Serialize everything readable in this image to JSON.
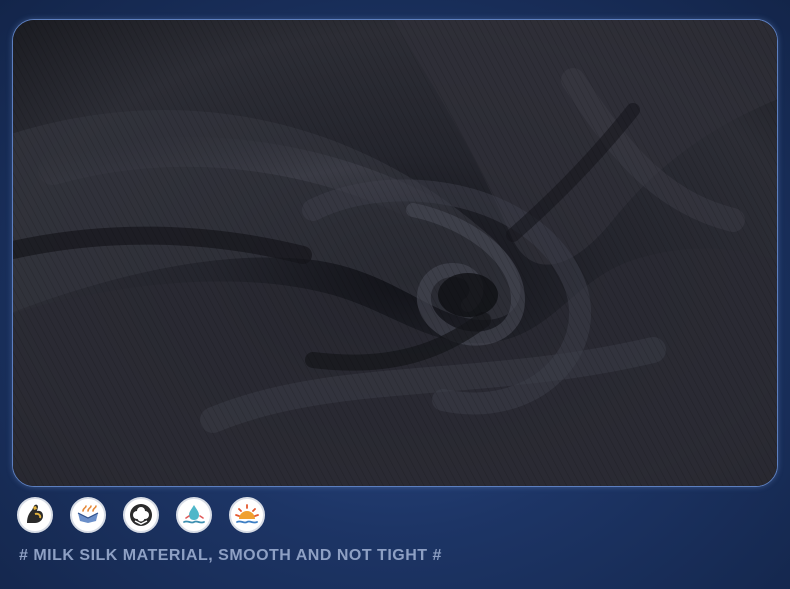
{
  "photo": {
    "subject": "black milk silk fabric swirl",
    "fabric_color": "#1d1e25"
  },
  "feature_icons": [
    {
      "name": "flexed-arm-icon"
    },
    {
      "name": "breathable-fabric-icon"
    },
    {
      "name": "cotton-flower-icon"
    },
    {
      "name": "quick-dry-icon"
    },
    {
      "name": "sun-protection-icon"
    }
  ],
  "caption": {
    "text": "# MILK SILK MATERIAL, SMOOTH AND NOT TIGHT #"
  },
  "colors": {
    "background": "#1d3566",
    "frame_border": "#5d7fbf",
    "caption_text": "#8ea0c4"
  }
}
